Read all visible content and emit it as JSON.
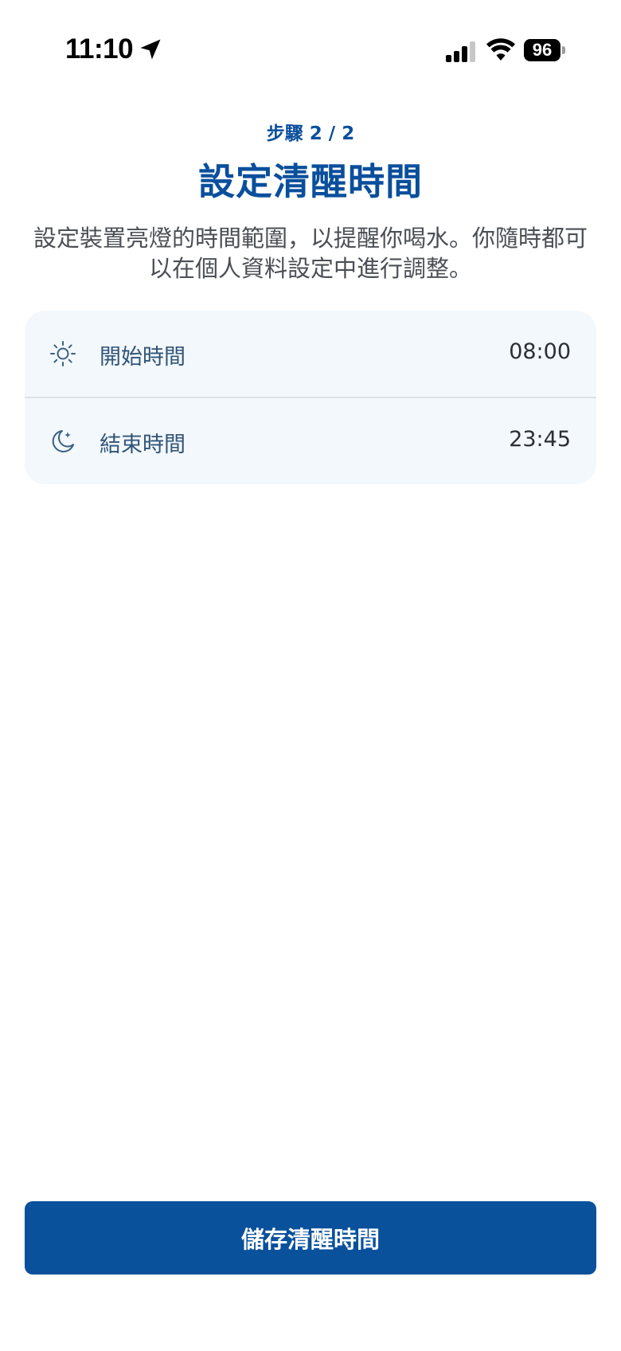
{
  "status_bar": {
    "time": "11:10",
    "battery": "96",
    "icons": [
      "location-arrow-icon",
      "signal-bars-icon",
      "wifi-icon",
      "battery-icon"
    ]
  },
  "header": {
    "step": "步驟 2 / 2",
    "title": "設定清醒時間",
    "description": "設定裝置亮燈的時間範圍，以提醒你喝水。你隨時都可以在個人資料設定中進行調整。"
  },
  "schedule": {
    "start": {
      "label": "開始時間",
      "value": "08:00",
      "icon": "sun-icon"
    },
    "end": {
      "label": "結束時間",
      "value": "23:45",
      "icon": "moon-icon"
    }
  },
  "footer": {
    "save_label": "儲存清醒時間"
  },
  "colors": {
    "brand": "#0a519c",
    "card_bg": "#f3f8fc",
    "label": "#2f5577"
  }
}
